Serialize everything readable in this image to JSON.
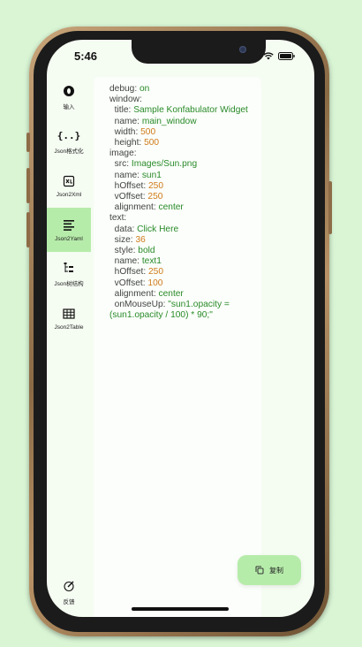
{
  "status": {
    "time": "5:46"
  },
  "sidebar": {
    "items": [
      {
        "label": "输入",
        "icon": "input-circle-icon"
      },
      {
        "label": "Json格式化",
        "icon": "braces-icon"
      },
      {
        "label": "Json2Xml",
        "icon": "xml-file-icon"
      },
      {
        "label": "Json2Yaml",
        "icon": "lines-icon"
      },
      {
        "label": "Json树结构",
        "icon": "tree-icon"
      },
      {
        "label": "Json2Table",
        "icon": "table-icon"
      }
    ],
    "active": "Json2Yaml",
    "feedback_label": "反馈"
  },
  "yaml": [
    {
      "indent": "",
      "key": "debug: ",
      "value": "on",
      "type": "s"
    },
    {
      "indent": "",
      "key": "window:",
      "value": "",
      "type": "s"
    },
    {
      "indent": "  ",
      "key": "title: ",
      "value": "Sample Konfabulator Widget",
      "type": "s"
    },
    {
      "indent": "  ",
      "key": "name: ",
      "value": "main_window",
      "type": "s"
    },
    {
      "indent": "  ",
      "key": "width: ",
      "value": "500",
      "type": "n"
    },
    {
      "indent": "  ",
      "key": "height: ",
      "value": "500",
      "type": "n"
    },
    {
      "indent": "",
      "key": "image:",
      "value": "",
      "type": "s"
    },
    {
      "indent": "  ",
      "key": "src: ",
      "value": "Images/Sun.png",
      "type": "s"
    },
    {
      "indent": "  ",
      "key": "name: ",
      "value": "sun1",
      "type": "s"
    },
    {
      "indent": "  ",
      "key": "hOffset: ",
      "value": "250",
      "type": "n"
    },
    {
      "indent": "  ",
      "key": "vOffset: ",
      "value": "250",
      "type": "n"
    },
    {
      "indent": "  ",
      "key": "alignment: ",
      "value": "center",
      "type": "s"
    },
    {
      "indent": "",
      "key": "text:",
      "value": "",
      "type": "s"
    },
    {
      "indent": "  ",
      "key": "data: ",
      "value": "Click Here",
      "type": "s"
    },
    {
      "indent": "  ",
      "key": "size: ",
      "value": "36",
      "type": "n"
    },
    {
      "indent": "  ",
      "key": "style: ",
      "value": "bold",
      "type": "s"
    },
    {
      "indent": "  ",
      "key": "name: ",
      "value": "text1",
      "type": "s"
    },
    {
      "indent": "  ",
      "key": "hOffset: ",
      "value": "250",
      "type": "n"
    },
    {
      "indent": "  ",
      "key": "vOffset: ",
      "value": "100",
      "type": "n"
    },
    {
      "indent": "  ",
      "key": "alignment: ",
      "value": "center",
      "type": "s"
    },
    {
      "indent": "  ",
      "key": "onMouseUp: ",
      "value": "\"sun1.opacity =",
      "type": "s"
    },
    {
      "indent": "",
      "key": "",
      "value": "(sun1.opacity / 100) * 90;\"",
      "type": "s"
    }
  ],
  "copy_button": {
    "label": "复制"
  },
  "colors": {
    "background": "#d9f5d4",
    "accent": "#b6ecaa",
    "string": "#2a8a2a",
    "number": "#d07a1a"
  }
}
